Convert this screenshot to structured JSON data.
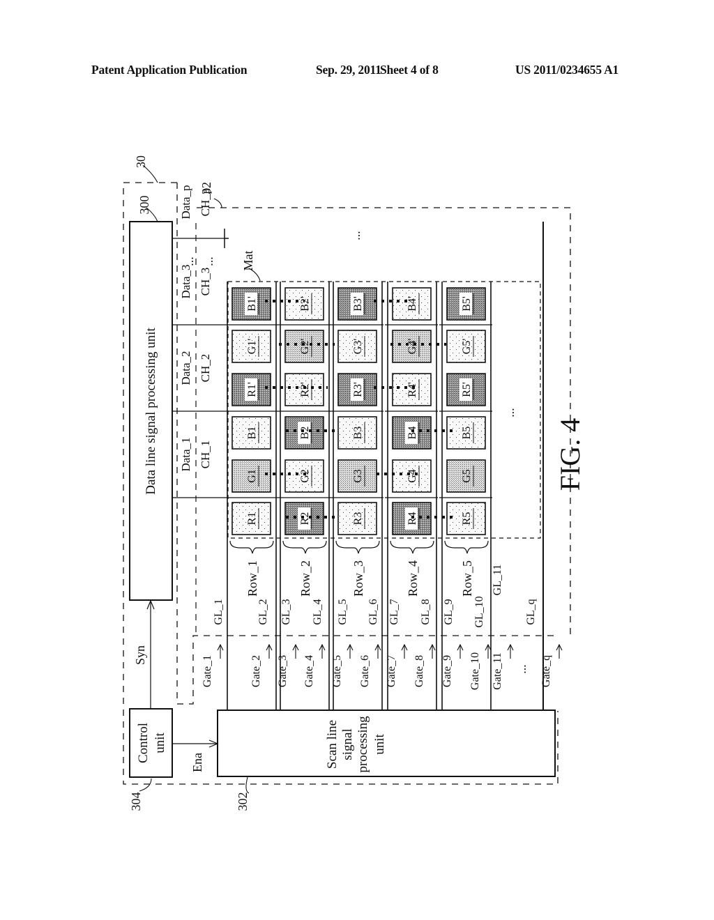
{
  "header": {
    "publication": "Patent Application Publication",
    "date": "Sep. 29, 2011",
    "sheet": "Sheet 4 of 8",
    "number": "US 2011/0234655 A1"
  },
  "figure": {
    "caption": "FIG. 4",
    "refs": {
      "driver": "30",
      "data_unit_ref": "300",
      "scan_unit_ref": "302",
      "control_ref": "304",
      "panel_ref": "32",
      "mat_label": "Mat"
    },
    "blocks": {
      "data_unit": "Data line signal processing unit",
      "scan_unit": [
        "Scan line",
        "signal",
        "processing",
        "unit"
      ],
      "control_unit": [
        "Control",
        "unit"
      ]
    },
    "signals": {
      "syn": "Syn",
      "ena": "Ena"
    },
    "data_lines": [
      {
        "data": "Data_1",
        "ch": "CH_1"
      },
      {
        "data": "Data_2",
        "ch": "CH_2"
      },
      {
        "data": "Data_3",
        "ch": "CH_3"
      },
      {
        "data": "Data_p",
        "ch": "CH_p"
      }
    ],
    "ellipsis": "...",
    "rows": [
      "Row_1",
      "Row_2",
      "Row_3",
      "Row_4",
      "Row_5"
    ],
    "gate_lines": [
      "GL_1",
      "GL_2",
      "GL_3",
      "GL_4",
      "GL_5",
      "GL_6",
      "GL_7",
      "GL_8",
      "GL_9",
      "GL_10",
      "GL_11",
      "GL_q"
    ],
    "gates": [
      "Gate_1",
      "Gate_2",
      "Gate_3",
      "Gate_4",
      "Gate_5",
      "Gate_6",
      "Gate_7",
      "Gate_8",
      "Gate_9",
      "Gate_10",
      "Gate_11",
      "Gate_q"
    ],
    "pixel_rows": [
      {
        "cells": [
          {
            "label": "B1'",
            "shade": "dark"
          },
          {
            "label": "G1'",
            "shade": "light"
          },
          {
            "label": "R1'",
            "shade": "dark"
          },
          {
            "label": "B1",
            "shade": "light"
          },
          {
            "label": "G1",
            "shade": "medium"
          },
          {
            "label": "R1",
            "shade": "light"
          }
        ]
      },
      {
        "cells": [
          {
            "label": "B2'",
            "shade": "light"
          },
          {
            "label": "G2'",
            "shade": "medium"
          },
          {
            "label": "R2'",
            "shade": "light"
          },
          {
            "label": "B2",
            "shade": "dark"
          },
          {
            "label": "G2",
            "shade": "light"
          },
          {
            "label": "R2",
            "shade": "dark"
          }
        ]
      },
      {
        "cells": [
          {
            "label": "B3'",
            "shade": "dark"
          },
          {
            "label": "G3'",
            "shade": "light"
          },
          {
            "label": "R3'",
            "shade": "dark"
          },
          {
            "label": "B3",
            "shade": "light"
          },
          {
            "label": "G3",
            "shade": "medium"
          },
          {
            "label": "R3",
            "shade": "light"
          }
        ]
      },
      {
        "cells": [
          {
            "label": "B4'",
            "shade": "light"
          },
          {
            "label": "G4'",
            "shade": "medium"
          },
          {
            "label": "R4'",
            "shade": "light"
          },
          {
            "label": "B4",
            "shade": "dark"
          },
          {
            "label": "G4",
            "shade": "light"
          },
          {
            "label": "R4",
            "shade": "dark"
          }
        ]
      },
      {
        "cells": [
          {
            "label": "B5'",
            "shade": "dark"
          },
          {
            "label": "G5'",
            "shade": "light"
          },
          {
            "label": "R5'",
            "shade": "dark"
          },
          {
            "label": "B5",
            "shade": "light"
          },
          {
            "label": "G5",
            "shade": "medium"
          },
          {
            "label": "R5",
            "shade": "light"
          }
        ]
      }
    ],
    "shade_colors": {
      "dark": "#8a8a8a",
      "medium": "#c4c4c4",
      "light": "#eeeeee"
    }
  }
}
